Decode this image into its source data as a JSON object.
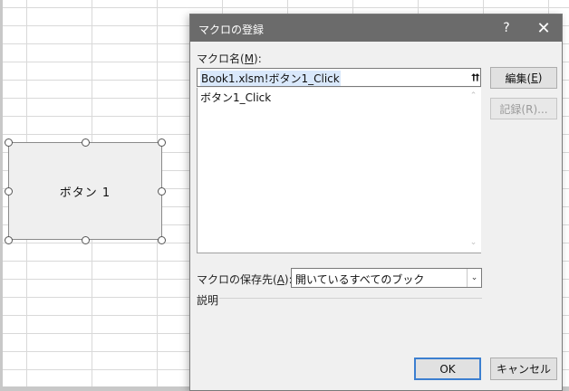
{
  "form_button": {
    "label": "ボタン 1"
  },
  "dialog": {
    "title": "マクロの登録",
    "help_glyph": "?",
    "close_glyph": "✕",
    "macro_name_label_pre": "マクロ名(",
    "macro_name_label_key": "M",
    "macro_name_label_post": "):",
    "macro_name_value": "Book1.xlsm!ボタン1_Click",
    "collapse_glyph": "⮅",
    "macro_list": [
      "ボタン1_Click"
    ],
    "scroll_up_glyph": "⌃",
    "scroll_down_glyph": "⌄",
    "edit_button": {
      "pre": "編集(",
      "key": "E",
      "post": ")"
    },
    "record_button": {
      "label": "記録(R)..."
    },
    "save_location_label_pre": "マクロの保存先(",
    "save_location_label_key": "A",
    "save_location_label_post": "):",
    "save_location_value": "開いているすべてのブック",
    "select_arrow_glyph": "⌄",
    "description_label": "説明",
    "ok_button": "OK",
    "cancel_button": "キャンセル"
  },
  "colors": {
    "titlebar": "#6b6b6b",
    "dialog_bg": "#f0f0f0",
    "default_button_border": "#3c7fd0",
    "selection_highlight": "#d9e8fb"
  }
}
